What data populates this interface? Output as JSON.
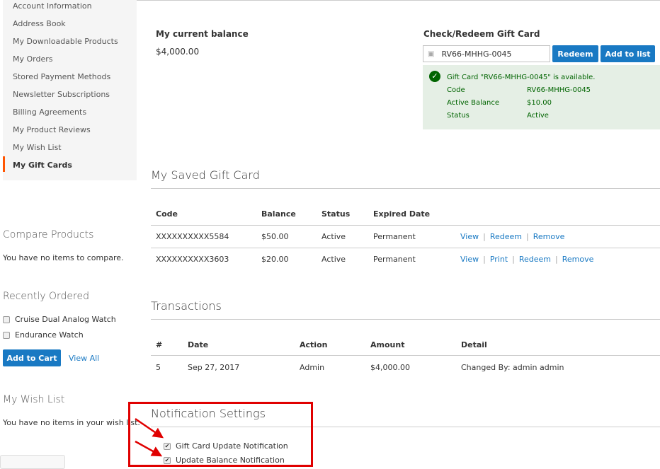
{
  "sidebar": {
    "items": [
      {
        "label": "Account Information"
      },
      {
        "label": "Address Book"
      },
      {
        "label": "My Downloadable Products"
      },
      {
        "label": "My Orders"
      },
      {
        "label": "Stored Payment Methods"
      },
      {
        "label": "Newsletter Subscriptions"
      },
      {
        "label": "Billing Agreements"
      },
      {
        "label": "My Product Reviews"
      },
      {
        "label": "My Wish List"
      },
      {
        "label": "My Gift Cards",
        "active": true
      }
    ],
    "accent": "#ff5501",
    "compare": {
      "title": "Compare Products",
      "empty": "You have no items to compare."
    },
    "recent": {
      "title": "Recently Ordered",
      "items": [
        "Cruise Dual Analog Watch",
        "Endurance Watch"
      ],
      "add_to_cart": "Add to Cart",
      "view_all": "View All"
    },
    "wishlist": {
      "title": "My Wish List",
      "empty": "You have no items in your wish list."
    }
  },
  "balance": {
    "title": "My current balance",
    "value": "$4,000.00"
  },
  "check": {
    "title": "Check/Redeem Gift Card",
    "input_value": "RV66-MHHG-0045",
    "redeem": "Redeem",
    "add_to_list": "Add to list",
    "message": {
      "text": "Gift Card \"RV66-MHHG-0045\" is available.",
      "rows": [
        [
          "Code",
          "RV66-MHHG-0045"
        ],
        [
          "Active Balance",
          "$10.00"
        ],
        [
          "Status",
          "Active"
        ]
      ]
    }
  },
  "saved": {
    "title": "My Saved Gift Card",
    "headers": [
      "Code",
      "Balance",
      "Status",
      "Expired Date"
    ],
    "rows": [
      {
        "code": "XXXXXXXXXX5584",
        "balance": "$50.00",
        "status": "Active",
        "expired": "Permanent",
        "actions": [
          "View",
          "Redeem",
          "Remove"
        ]
      },
      {
        "code": "XXXXXXXXXX3603",
        "balance": "$20.00",
        "status": "Active",
        "expired": "Permanent",
        "actions": [
          "View",
          "Print",
          "Redeem",
          "Remove"
        ]
      }
    ]
  },
  "transactions": {
    "title": "Transactions",
    "headers": [
      "#",
      "Date",
      "Action",
      "Amount",
      "Detail"
    ],
    "rows": [
      [
        "5",
        "Sep 27, 2017",
        "Admin",
        "$4,000.00",
        "Changed By: admin admin"
      ]
    ]
  },
  "notifications": {
    "title": "Notification Settings",
    "options": [
      {
        "label": "Gift Card Update Notification",
        "checked": true
      },
      {
        "label": "Update Balance Notification",
        "checked": true
      }
    ],
    "highlight": "#e00000"
  },
  "colors": {
    "primary": "#1979c3",
    "success_bg": "#e5efe5",
    "success_text": "#006400"
  }
}
